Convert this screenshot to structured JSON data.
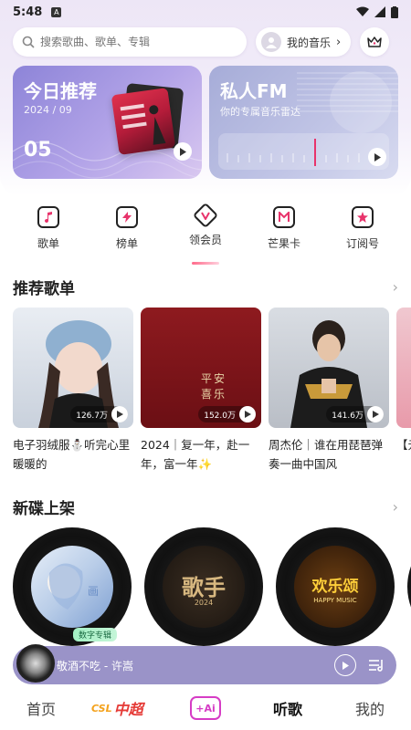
{
  "status_bar": {
    "time": "5:48",
    "notif_letter": "A"
  },
  "search": {
    "placeholder": "搜索歌曲、歌单、专辑"
  },
  "my_music": {
    "label": "我的音乐"
  },
  "daily": {
    "title": "今日推荐",
    "month": "2024 / 09",
    "day": "05"
  },
  "fm": {
    "title": "私人FM",
    "subtitle": "你的专属音乐雷达"
  },
  "categories": [
    {
      "label": "歌单",
      "icon": "music-note-icon"
    },
    {
      "label": "榜单",
      "icon": "lightning-icon"
    },
    {
      "label": "领会员",
      "icon": "vip-icon"
    },
    {
      "label": "芒果卡",
      "icon": "mango-card-icon"
    },
    {
      "label": "订阅号",
      "icon": "star-icon"
    }
  ],
  "recommended": {
    "title": "推荐歌单",
    "items": [
      {
        "name": "电子羽绒服⛄听完心里暖暖的",
        "count": "126.7万"
      },
      {
        "name": "2024｜复一年，赴一年，富一年✨",
        "count": "152.0万",
        "cover_text": "平安喜乐"
      },
      {
        "name": "周杰伦｜谁在用琵琶弹奏一曲中国风",
        "count": "141.6万"
      },
      {
        "name": "【元魂继"
      }
    ]
  },
  "new_albums": {
    "title": "新碟上架",
    "items": [
      {
        "badge": "数字专辑"
      },
      {
        "cover_text": "歌手",
        "cover_sub": "2024"
      },
      {
        "cover_text": "欢乐颂",
        "cover_sub": "HAPPY MUSIC"
      }
    ]
  },
  "mini_player": {
    "title": "敬酒不吃 - 许嵩"
  },
  "bottom_nav": {
    "home": "首页",
    "csl": "中超",
    "csl_small": "CSL",
    "ai": "+Ai",
    "listen": "听歌",
    "mine": "我的"
  },
  "colors": {
    "accent": "#e8336b",
    "player_bg": "#9a93c8"
  }
}
